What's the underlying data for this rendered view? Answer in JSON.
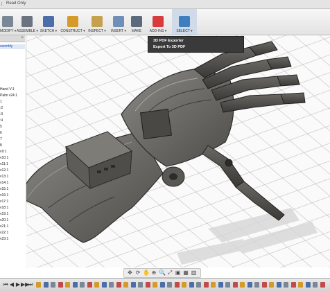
{
  "window": {
    "title": "Read Only"
  },
  "toolbar": {
    "items": [
      {
        "label": "MODIFY ▾",
        "icon": "modify-icon",
        "color": "#7a8796"
      },
      {
        "label": "ASSEMBLE ▾",
        "icon": "assemble-icon",
        "color": "#6b7380"
      },
      {
        "label": "SKETCH ▾",
        "icon": "sketch-icon",
        "color": "#4c6ea8"
      },
      {
        "label": "CONSTRUCT ▾",
        "icon": "construct-icon",
        "color": "#d59a2a"
      },
      {
        "label": "INSPECT ▾",
        "icon": "inspect-icon",
        "color": "#c4a24d"
      },
      {
        "label": "INSERT ▾",
        "icon": "insert-icon",
        "color": "#6f8fb8"
      },
      {
        "label": "MAKE",
        "icon": "make-icon",
        "color": "#5b6a7c"
      },
      {
        "label": "ADD-INS ▾",
        "icon": "add-ins-icon",
        "color": "#d83b3b"
      },
      {
        "label": "SELECT ▾",
        "icon": "select-icon",
        "color": "#3f7fc0"
      }
    ]
  },
  "addins_menu": {
    "items": [
      "3D PDF Exporter",
      "Export To 3D PDF"
    ]
  },
  "browser": {
    "close_icon": "×",
    "assembly_label": "ssembly",
    "rows": [
      "Hand V:1",
      "Palm v24:1",
      "1",
      ":2",
      ":3",
      ":4",
      "5",
      "6",
      "7",
      "8",
      "v9:1",
      "v10:1",
      "v11:1",
      "v12:1",
      "v13:1",
      "v14:1",
      "v15:1",
      "v16:1",
      "v17:1",
      "v18:1",
      "v19:1",
      "v20:1",
      "v21:1",
      "v22:1",
      "v23:1"
    ]
  },
  "navbar": {
    "icons": [
      "move-icon",
      "orbit-icon",
      "pan-icon",
      "zoom-icon",
      "zoom-window-icon",
      "fit-icon",
      "display-settings-icon",
      "grid-icon",
      "viewport-icon"
    ],
    "glyphs": [
      "✥",
      "⟳",
      "✋",
      "⊕",
      "🔍",
      "⤢",
      "▣",
      "▦",
      "▥"
    ]
  },
  "timeline": {
    "glyphs": [
      "⏮",
      "◀",
      "▶",
      "▶▶",
      "⏭"
    ],
    "feature_count": 40
  }
}
